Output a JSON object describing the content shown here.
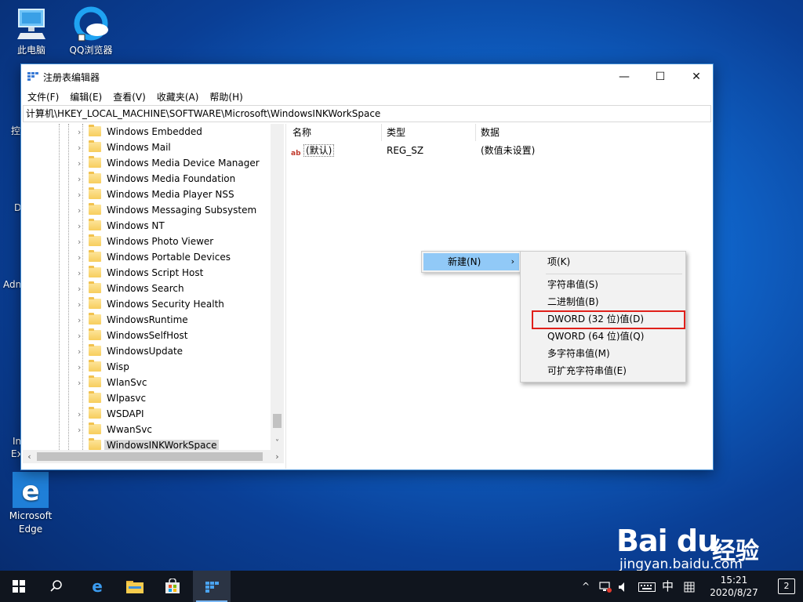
{
  "desktop": {
    "icons": [
      {
        "label": "此电脑"
      },
      {
        "label": "QQ浏览器"
      },
      {
        "label": "Microsoft Edge"
      }
    ],
    "partial_labels": [
      "控",
      "D",
      "Adn",
      "In",
      "Ex"
    ]
  },
  "window": {
    "title": "注册表编辑器",
    "controls": {
      "minimize": "—",
      "maximize": "☐",
      "close": "✕"
    },
    "menu": [
      "文件(F)",
      "编辑(E)",
      "查看(V)",
      "收藏夹(A)",
      "帮助(H)"
    ],
    "address": "计算机\\HKEY_LOCAL_MACHINE\\SOFTWARE\\Microsoft\\WindowsINKWorkSpace",
    "tree_items": [
      "Windows Embedded",
      "Windows Mail",
      "Windows Media Device Manager",
      "Windows Media Foundation",
      "Windows Media Player NSS",
      "Windows Messaging Subsystem",
      "Windows NT",
      "Windows Photo Viewer",
      "Windows Portable Devices",
      "Windows Script Host",
      "Windows Search",
      "Windows Security Health",
      "WindowsRuntime",
      "WindowsSelfHost",
      "WindowsUpdate",
      "Wisp",
      "WlanSvc",
      "Wlpasvc",
      "WSDAPI",
      "WwanSvc",
      "WindowsINKWorkSpace"
    ],
    "columns": [
      "名称",
      "类型",
      "数据"
    ],
    "values": [
      {
        "name": "(默认)",
        "type": "REG_SZ",
        "data": "(数值未设置)"
      }
    ]
  },
  "context_menu": {
    "parent": {
      "label": "新建(N)",
      "arrow": "›"
    },
    "submenu": [
      "项(K)",
      "字符串值(S)",
      "二进制值(B)",
      "DWORD (32 位)值(D)",
      "QWORD (64 位)值(Q)",
      "多字符串值(M)",
      "可扩充字符串值(E)"
    ],
    "highlight_color": "#e0201a"
  },
  "taskbar": {
    "ime_mode": "中",
    "clock_time": "15:21",
    "clock_date": "2020/8/27",
    "notifications": "2"
  },
  "watermark": {
    "brand": "Bai du",
    "product": "经验",
    "url": "jingyan.baidu.com"
  }
}
